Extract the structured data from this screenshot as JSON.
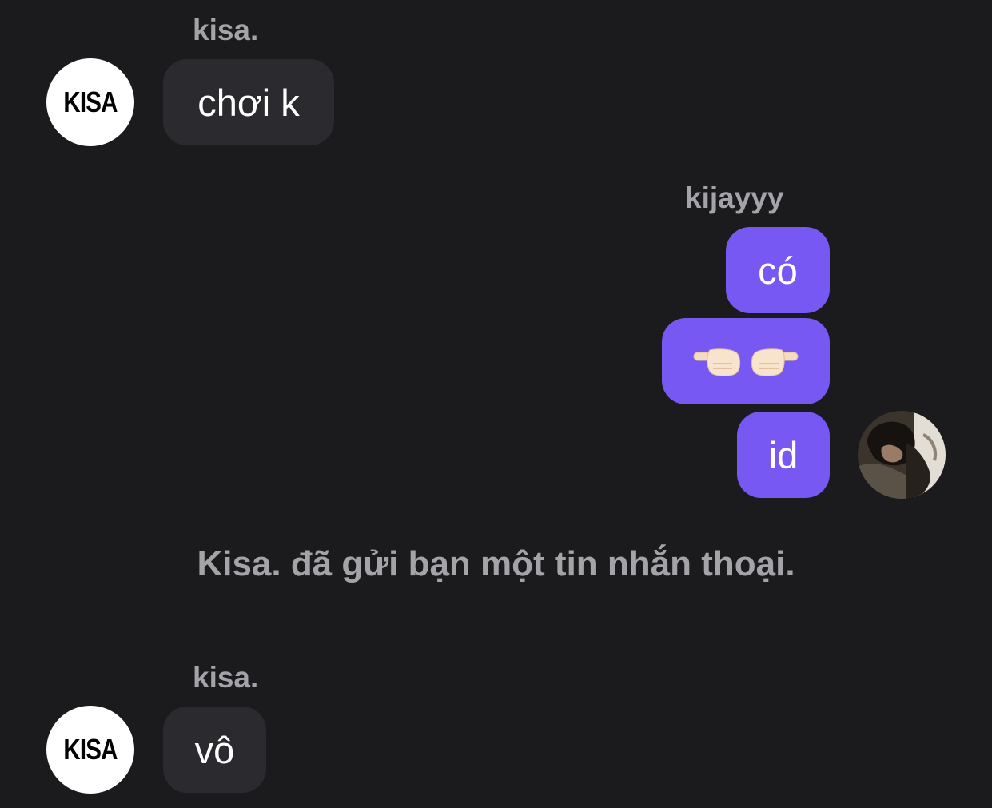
{
  "messages": [
    {
      "sender": "kisa.",
      "text": "chơi k"
    },
    {
      "sender": "kijayyy",
      "texts": [
        "có",
        "",
        "id"
      ]
    },
    {
      "system": "Kisa. đã gửi bạn một tin nhắn thoại."
    },
    {
      "sender": "kisa.",
      "text": "vô"
    }
  ],
  "avatars": {
    "kisa_logo_text": "KISA"
  },
  "icons": {
    "reaction_emoji": "pointing-fingers-icon"
  },
  "colors": {
    "background": "#1b1a1d",
    "incoming_bubble": "#2b2a2e",
    "outgoing_bubble": "#7758f3",
    "name_text": "#a4a3a8"
  }
}
